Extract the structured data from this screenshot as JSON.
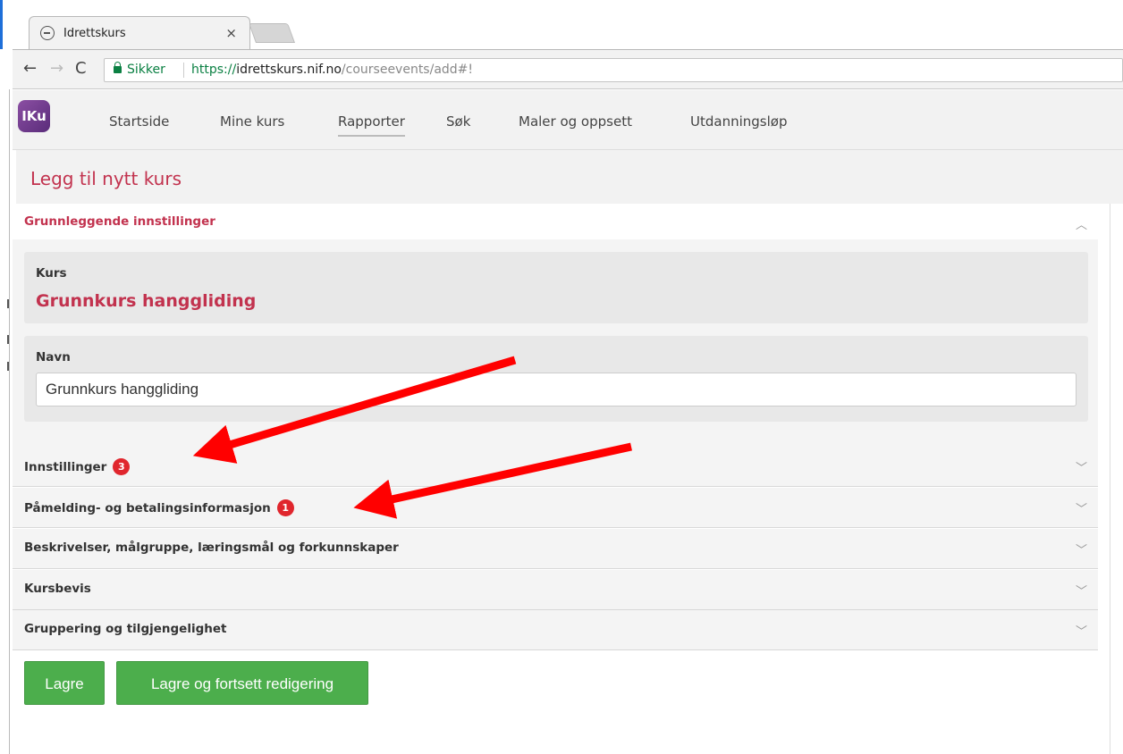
{
  "browser": {
    "tab_title": "Idrettskurs",
    "tab_close": "×",
    "secure_label": "Sikker",
    "url_scheme": "https://",
    "url_host": "idrettskurs.nif.no",
    "url_path": "/courseevents/add#!"
  },
  "app": {
    "logo_text": "IKu",
    "nav": [
      "Startside",
      "Mine kurs",
      "Rapporter",
      "Søk",
      "Maler og oppsett",
      "Utdanningsløp"
    ],
    "active_nav": "Rapporter"
  },
  "page": {
    "title": "Legg til nytt kurs"
  },
  "basic_settings": {
    "header": "Grunnleggende innstillinger",
    "kurs_label": "Kurs",
    "kurs_value": "Grunnkurs hanggliding",
    "navn_label": "Navn",
    "navn_value": "Grunnkurs hanggliding"
  },
  "sections": [
    {
      "label": "Innstillinger",
      "badge": "3"
    },
    {
      "label": "Påmelding- og betalingsinformasjon",
      "badge": "1"
    },
    {
      "label": "Beskrivelser, målgruppe, læringsmål og forkunnskaper",
      "badge": null
    },
    {
      "label": "Kursbevis",
      "badge": null
    },
    {
      "label": "Gruppering og tilgjengelighet",
      "badge": null
    }
  ],
  "buttons": {
    "save": "Lagre",
    "save_continue": "Lagre og fortsett redigering"
  },
  "colors": {
    "accent": "#c2324e",
    "badge": "#e0262d",
    "button": "#4cae4c",
    "secure": "#0b8043",
    "annotation_arrow": "#ff0000"
  },
  "icons": {
    "back": "back-arrow-icon",
    "forward": "forward-arrow-icon",
    "reload": "reload-icon",
    "lock": "lock-icon",
    "chevron_up": "chevron-up-icon",
    "chevron_down": "chevron-down-icon"
  }
}
